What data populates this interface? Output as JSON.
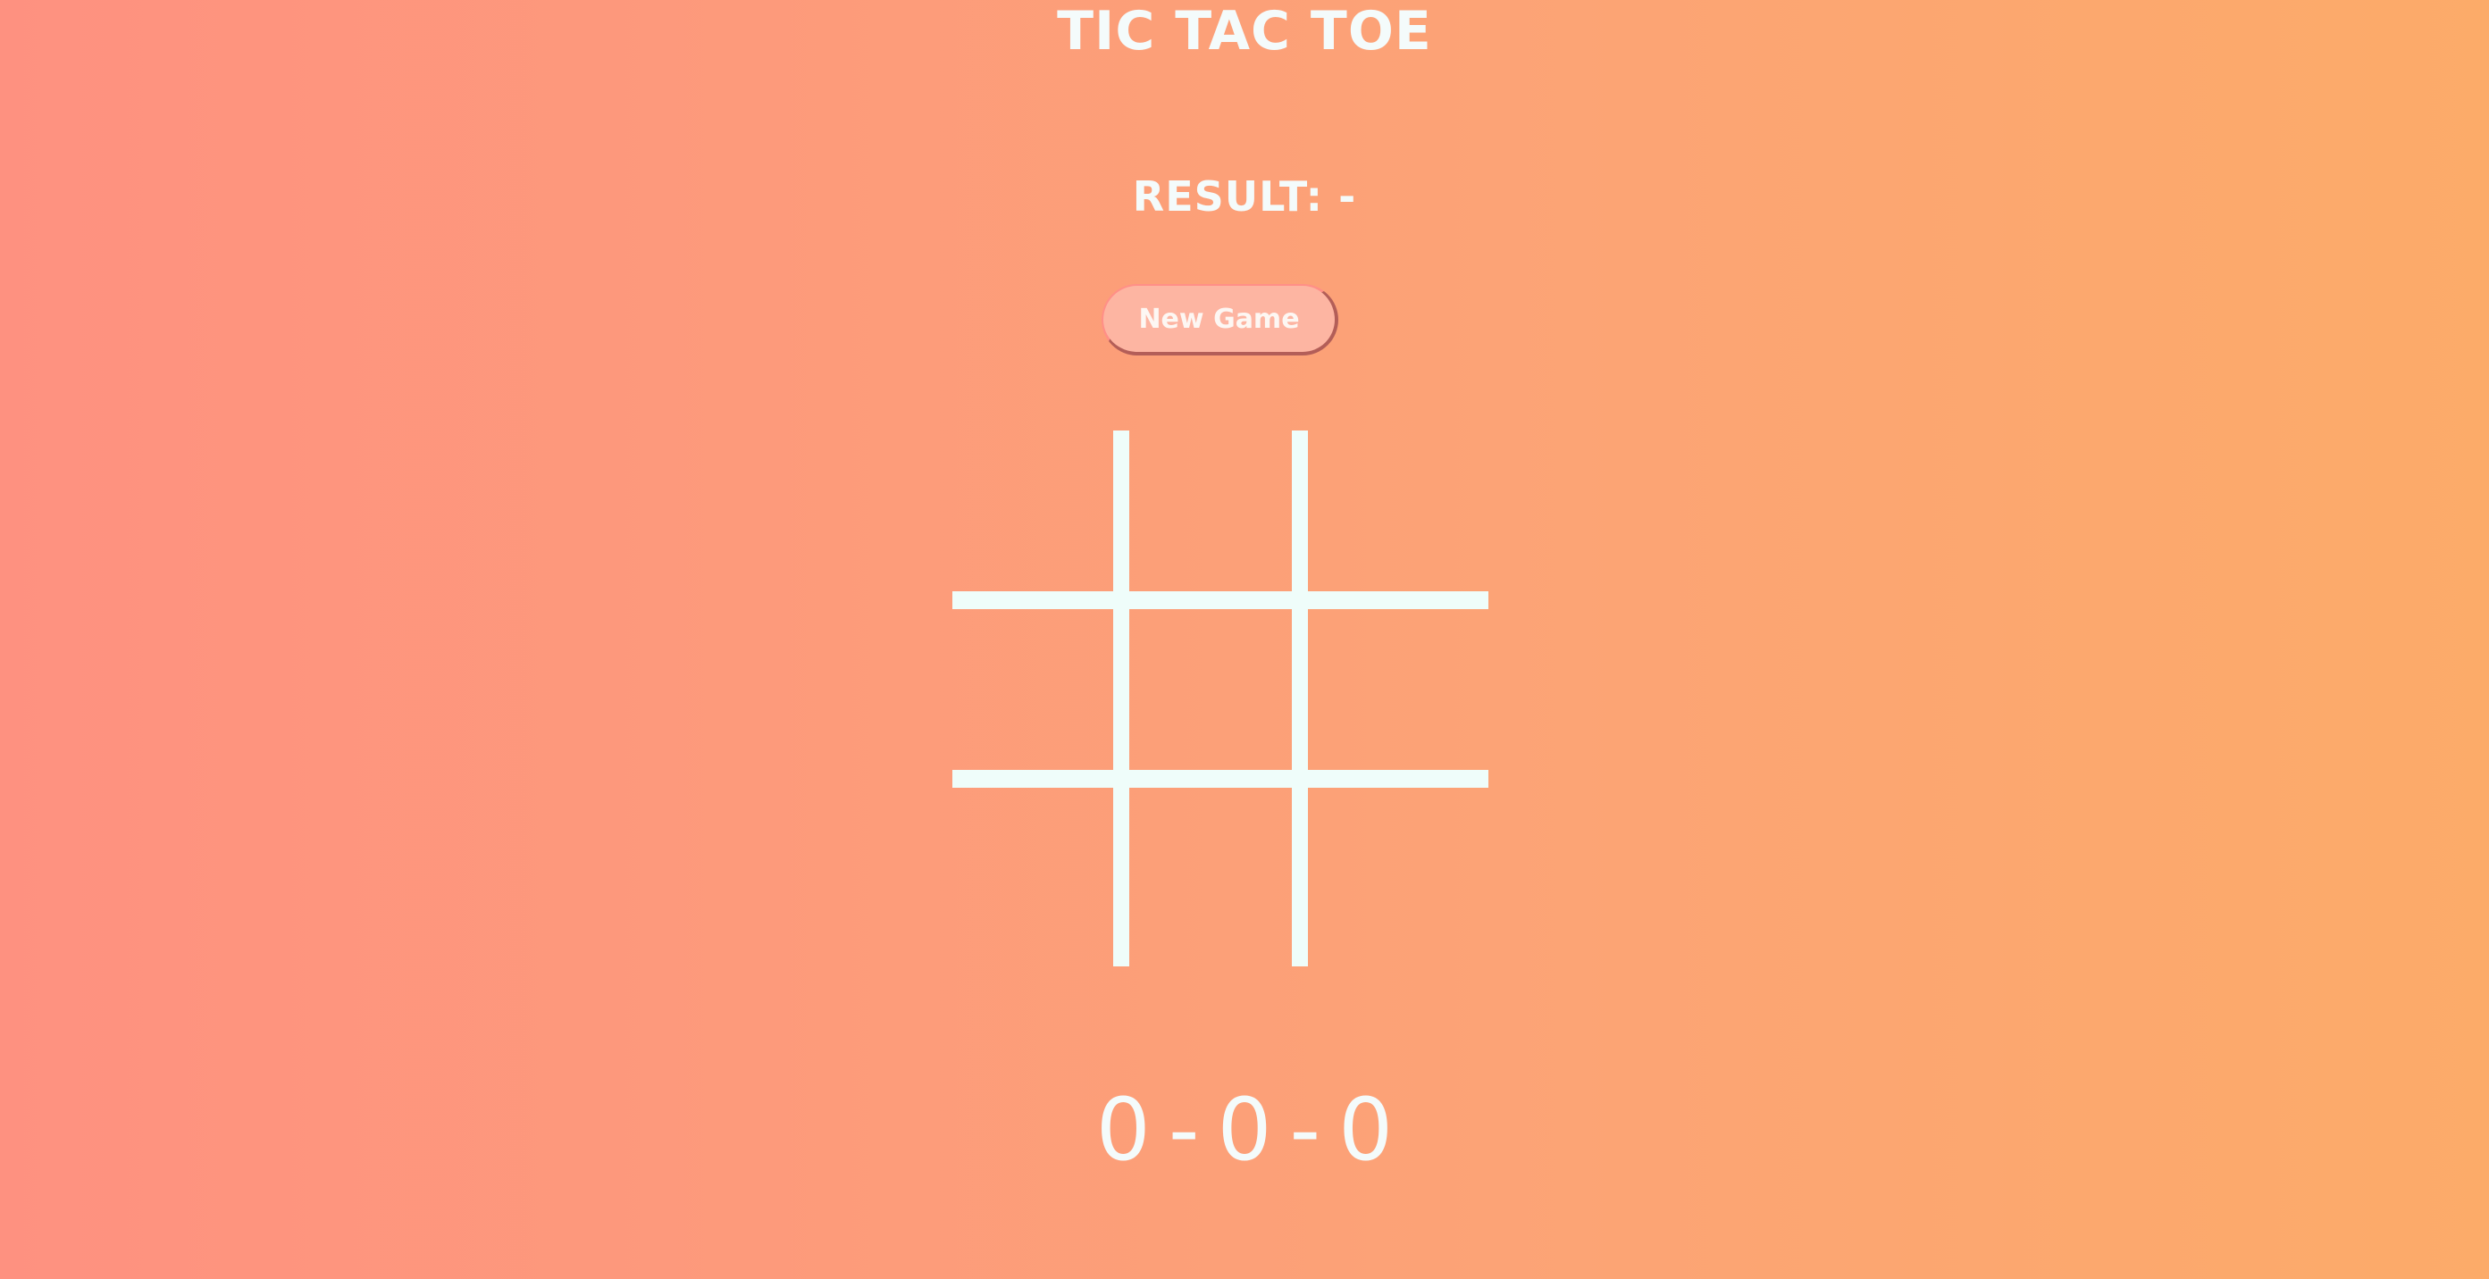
{
  "game": {
    "title": "TIC TAC TOE",
    "result_label": "RESULT: -",
    "new_game_label": "New Game",
    "board": {
      "cells": [
        "",
        "",
        "",
        "",
        "",
        "",
        "",
        "",
        ""
      ]
    },
    "score": {
      "x_wins": "0",
      "separator1": "-",
      "draws": "0",
      "separator2": "-",
      "o_wins": "0"
    }
  },
  "colors": {
    "background_start": "#fe9180",
    "background_end": "#fcab69",
    "foreground": "#f4fbfb",
    "grid_lines": "#effdfa",
    "button_fill": "#fdb5a2",
    "button_border": "#ff8f87",
    "button_shadow": "#b35e58"
  }
}
